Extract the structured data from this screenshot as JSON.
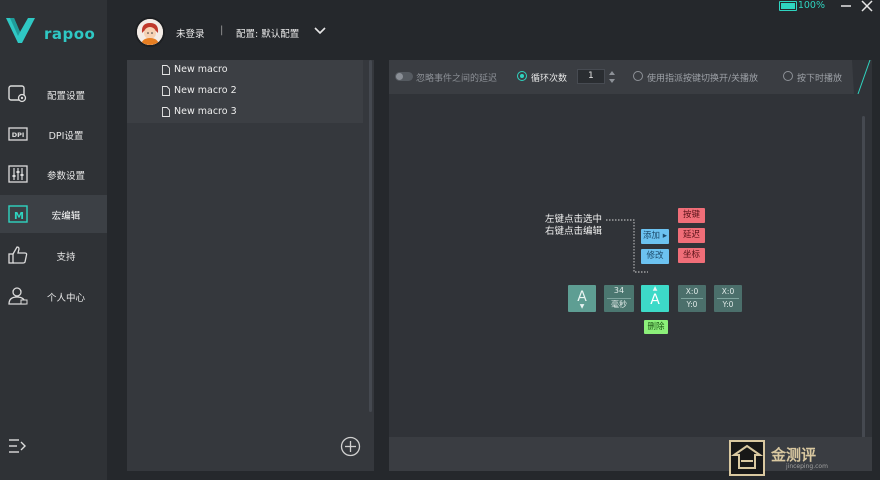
{
  "brand": {
    "name": "rapoo"
  },
  "sidebar": {
    "items": [
      {
        "label": "配置设置",
        "icon": "config-icon"
      },
      {
        "label": "DPI设置",
        "icon": "dpi-icon"
      },
      {
        "label": "参数设置",
        "icon": "sliders-icon"
      },
      {
        "label": "宏编辑",
        "icon": "macro-icon",
        "active": true
      },
      {
        "label": "支持",
        "icon": "thumbs-up-icon"
      },
      {
        "label": "个人中心",
        "icon": "user-icon"
      }
    ]
  },
  "topbar": {
    "login_status": "未登录",
    "separator": "|",
    "config_label": "配置: 默认配置",
    "battery_percent": 100,
    "battery_text": "100%"
  },
  "macros": [
    {
      "label": "New macro"
    },
    {
      "label": "New macro 2"
    },
    {
      "label": "New macro 3"
    }
  ],
  "toolbar": {
    "ignore_delay_label": "忽略事件之间的延迟",
    "ignore_delay_on": false,
    "loop_label": "循环次数",
    "loop_count": "1",
    "toggle_key_label": "使用指派按键切换开/关播放",
    "hold_play_label": "按下时播放",
    "selected_mode": "loop"
  },
  "demo": {
    "hint_select": "左键点击选中",
    "hint_edit": "右键点击编辑",
    "add_label": "添加 ▸",
    "modify_label": "修改",
    "key_label": "按键",
    "delay_label": "延迟",
    "coord_label": "坐标",
    "delete_label": "删除",
    "key_char": "A",
    "delay_value": "34",
    "delay_unit": "毫秒",
    "coord1_x": "X:0",
    "coord1_y": "Y:0",
    "coord2_x": "X:0",
    "coord2_y": "Y:0"
  },
  "watermark": {
    "text": "金测评",
    "sub": "jinceping.com"
  },
  "colors": {
    "accent": "#2fd4c0",
    "sidebar_bg": "#2f3236",
    "panel_bg": "#35383d"
  }
}
